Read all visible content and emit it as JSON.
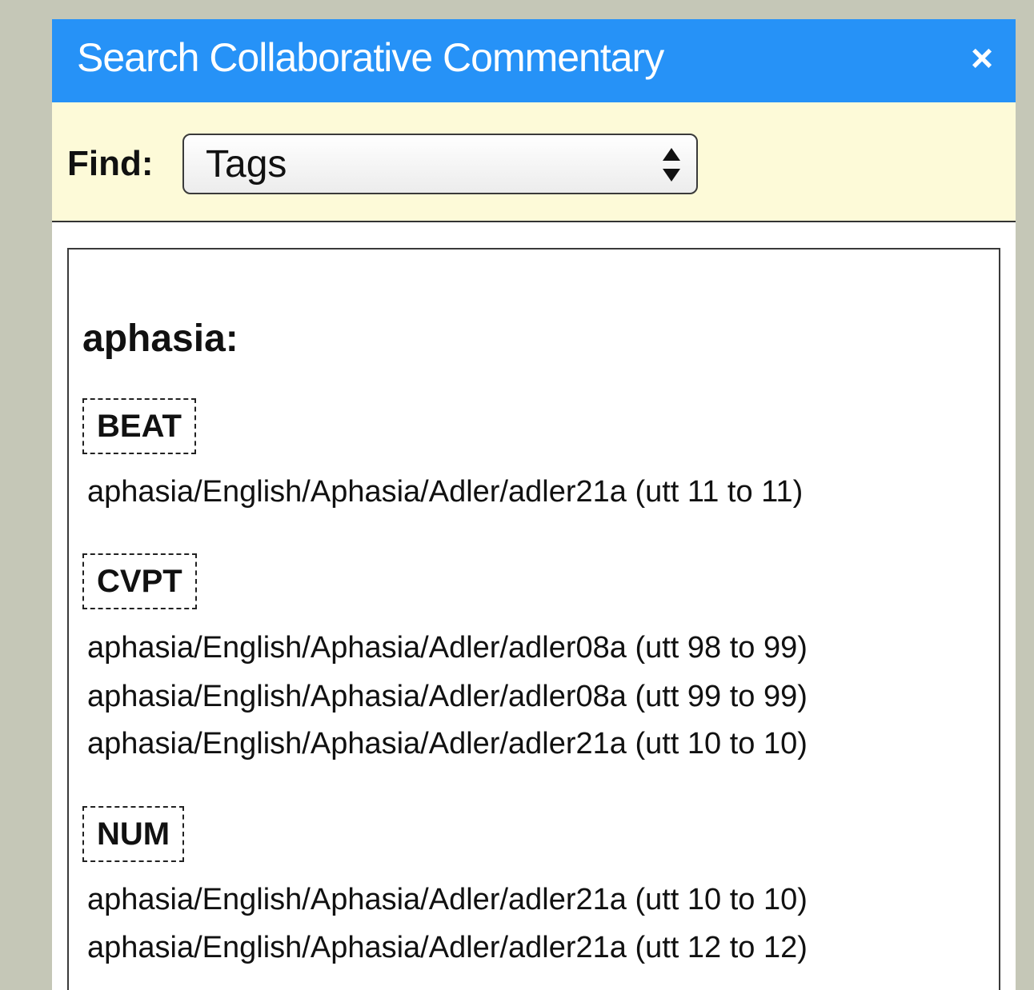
{
  "dialog": {
    "title": "Search Collaborative Commentary",
    "close_label": "×"
  },
  "find": {
    "label": "Find:",
    "selected_option": "Tags"
  },
  "results": {
    "corpus": "aphasia:",
    "groups": [
      {
        "tag": "BEAT",
        "hits": [
          "aphasia/English/Aphasia/Adler/adler21a (utt 11 to 11)"
        ]
      },
      {
        "tag": "CVPT",
        "hits": [
          "aphasia/English/Aphasia/Adler/adler08a (utt 98 to 99)",
          "aphasia/English/Aphasia/Adler/adler08a (utt 99 to 99)",
          "aphasia/English/Aphasia/Adler/adler21a (utt 10 to 10)"
        ]
      },
      {
        "tag": "NUM",
        "hits": [
          "aphasia/English/Aphasia/Adler/adler21a (utt 10 to 10)",
          "aphasia/English/Aphasia/Adler/adler21a (utt 12 to 12)"
        ]
      }
    ]
  }
}
